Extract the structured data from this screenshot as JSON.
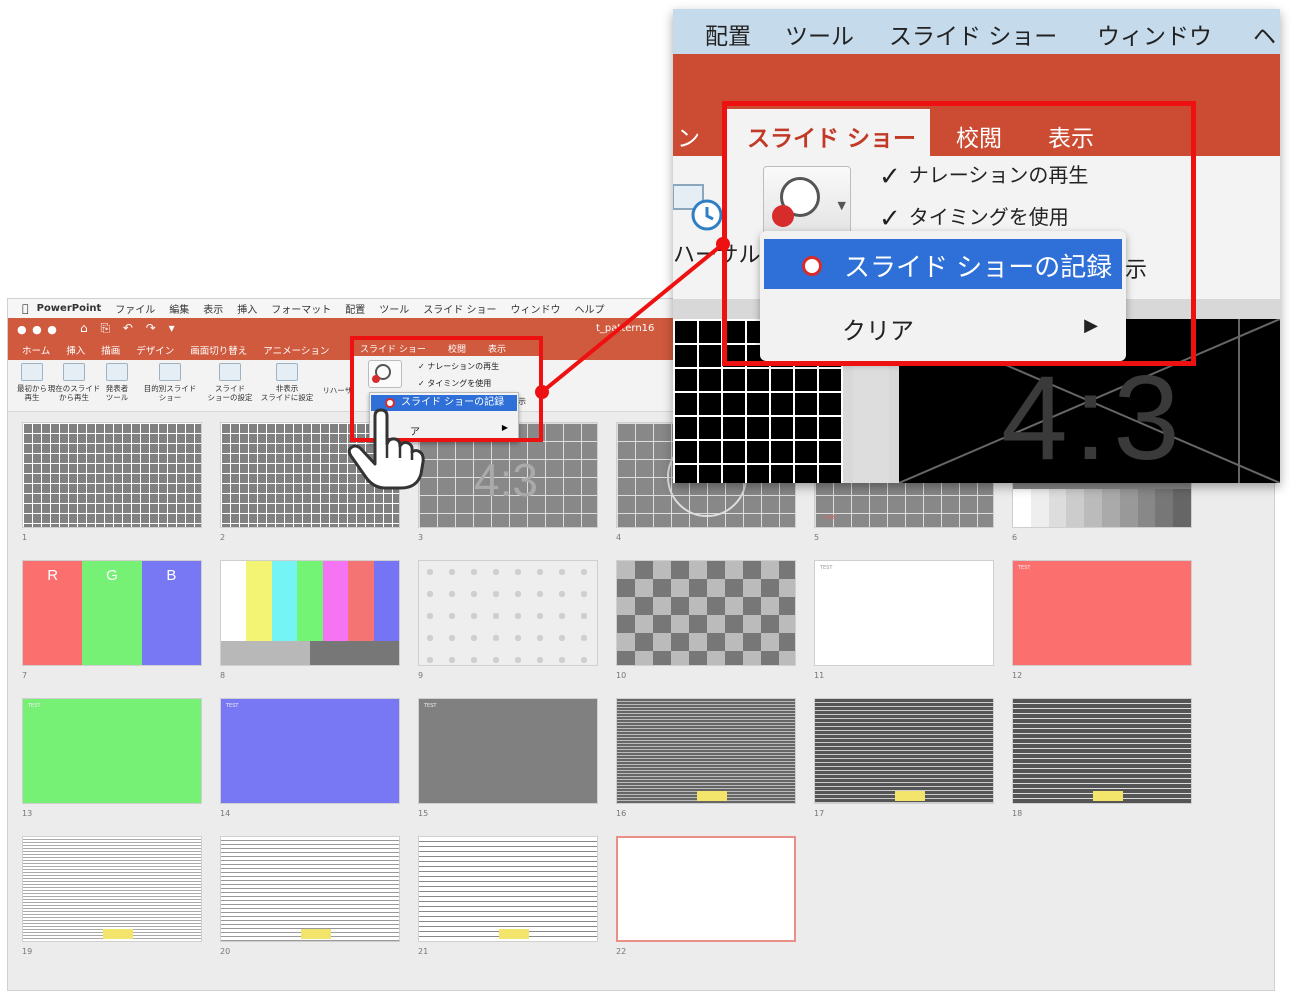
{
  "menubar": {
    "apple": "",
    "items": [
      "PowerPoint",
      "ファイル",
      "編集",
      "表示",
      "挿入",
      "フォーマット",
      "配置",
      "ツール",
      "スライド ショー",
      "ウィンドウ",
      "ヘルプ"
    ]
  },
  "titlebar": {
    "window_controls": "● ● ●",
    "doc_title": "t_pattern16",
    "quick_access": [
      "⌂",
      "⎘",
      "↶",
      "↷",
      "▾"
    ]
  },
  "ribbon_tabs": [
    "ホーム",
    "挿入",
    "描画",
    "デザイン",
    "画面切り替え",
    "アニメーション"
  ],
  "toolbar": [
    {
      "label": "最初から\n再生"
    },
    {
      "label": "現在のスライド\nから再生"
    },
    {
      "label": "発表者\nツール"
    },
    {
      "label": "目的別スライド\nショー"
    },
    {
      "label": "スライド\nショーの設定"
    },
    {
      "label": "非表示\nスライドに設定"
    },
    {
      "label": "リハーサル"
    }
  ],
  "small_highlight": {
    "tabs": [
      "スライド ショー",
      "校閲",
      "表示"
    ],
    "checks": [
      "ナレーションの再生",
      "タイミングを使用"
    ],
    "menu_record": "スライド ショーの記録",
    "menu_clear": "ア",
    "extra": "示"
  },
  "slides": [
    {
      "n": "1"
    },
    {
      "n": "2"
    },
    {
      "n": "3",
      "text": "4:3"
    },
    {
      "n": "4"
    },
    {
      "n": "5",
      "label": "RGB"
    },
    {
      "n": "6"
    },
    {
      "n": "7",
      "r": "R",
      "g": "G",
      "b": "B"
    },
    {
      "n": "8"
    },
    {
      "n": "9"
    },
    {
      "n": "10"
    },
    {
      "n": "11",
      "label": "TEST"
    },
    {
      "n": "12",
      "label": "TEST"
    },
    {
      "n": "13",
      "label": "TEST"
    },
    {
      "n": "14",
      "label": "TEST"
    },
    {
      "n": "15",
      "label": "TEST"
    },
    {
      "n": "16"
    },
    {
      "n": "17"
    },
    {
      "n": "18"
    },
    {
      "n": "19"
    },
    {
      "n": "20"
    },
    {
      "n": "21"
    },
    {
      "n": "22"
    }
  ],
  "zoom": {
    "menubar": [
      "配置",
      "ツール",
      "スライド ショー",
      "ウィンドウ",
      "ヘ"
    ],
    "tabs_left": "ン",
    "tab_active": "スライド ショー",
    "tabs": [
      "校閲",
      "表示"
    ],
    "check1": "ナレーションの再生",
    "check2": "タイミングを使用",
    "check_mark": "✓",
    "left_label": "ハーサル",
    "right_label": "示",
    "menu_record": "スライド ショーの記録",
    "menu_clear": "クリア",
    "menu_arrow": "▶",
    "ratio": "4:3"
  },
  "colors": {
    "ribbon": "#d05a3e",
    "highlight": "#ee1111",
    "menu_selected": "#2f6fd8",
    "zoom_menubar": "#c5daeb"
  }
}
